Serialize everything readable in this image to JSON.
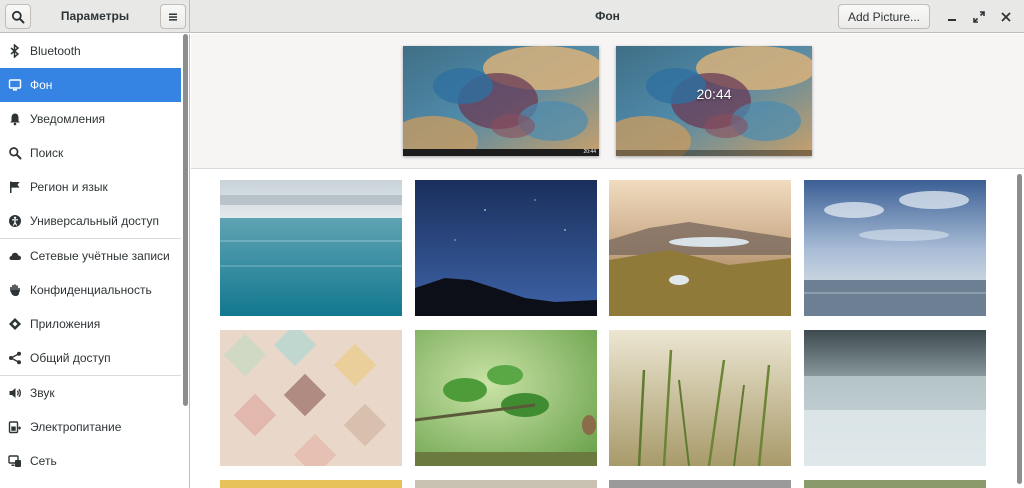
{
  "window": {
    "app_title": "Параметры",
    "panel_title": "Фон",
    "add_picture_label": "Add Picture..."
  },
  "sidebar": {
    "items": [
      {
        "label": "Bluetooth",
        "icon": "bluetooth-icon",
        "selected": false
      },
      {
        "label": "Фон",
        "icon": "monitor-icon",
        "selected": true
      },
      {
        "label": "Уведомления",
        "icon": "bell-icon",
        "selected": false
      },
      {
        "label": "Поиск",
        "icon": "search-icon",
        "selected": false
      },
      {
        "label": "Регион и язык",
        "icon": "flag-icon",
        "selected": false
      },
      {
        "label": "Универсальный доступ",
        "icon": "accessibility-icon",
        "selected": false
      },
      {
        "label": "Сетевые учётные записи",
        "icon": "cloud-icon",
        "selected": false
      },
      {
        "label": "Конфиденциальность",
        "icon": "hand-icon",
        "selected": false
      },
      {
        "label": "Приложения",
        "icon": "apps-icon",
        "selected": false
      },
      {
        "label": "Общий доступ",
        "icon": "share-icon",
        "selected": false
      },
      {
        "label": "Звук",
        "icon": "speaker-icon",
        "selected": false
      },
      {
        "label": "Электропитание",
        "icon": "power-icon",
        "selected": false
      },
      {
        "label": "Сеть",
        "icon": "network-icon",
        "selected": false
      }
    ]
  },
  "previews": {
    "desktop_clock": "20:44",
    "lock_clock": "20:44"
  },
  "wallpapers": [
    {
      "name": "sea-horizon"
    },
    {
      "name": "night-sky-mountains"
    },
    {
      "name": "mountain-lake-valley"
    },
    {
      "name": "clouds-over-sea"
    },
    {
      "name": "pastel-scales"
    },
    {
      "name": "green-leaves-bird"
    },
    {
      "name": "grass-blades-sunlight"
    },
    {
      "name": "frosted-meadow"
    }
  ],
  "colors": {
    "accent": "#3584e4",
    "header_bg": "#e8e8e7",
    "sidebar_selected_text": "#ffffff"
  }
}
